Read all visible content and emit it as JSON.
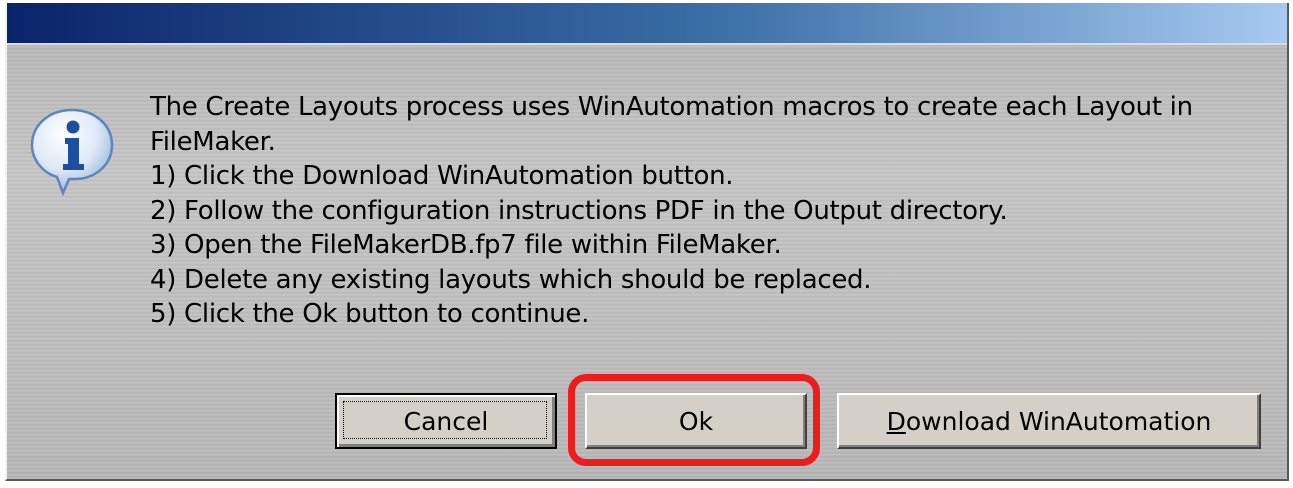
{
  "dialog": {
    "title": "",
    "icon": "information-icon",
    "message_lines": [
      "The Create Layouts process uses WinAutomation macros to create each Layout in",
      "FileMaker.",
      "1) Click the Download WinAutomation button.",
      "2) Follow the configuration instructions PDF in the Output directory.",
      "3) Open the FileMakerDB.fp7 file within FileMaker.",
      "4) Delete any existing layouts which should be replaced.",
      "5) Click the Ok button to continue."
    ]
  },
  "buttons": {
    "cancel_label": "Cancel",
    "ok_label": "Ok",
    "download_label_accel": "D",
    "download_label_rest": "ownload WinAutomation"
  },
  "annotation": {
    "highlight_color": "#ee1c1c",
    "highlight_target": "ok-button"
  },
  "colors": {
    "titlebar_start": "#0a246a",
    "titlebar_end": "#a6caf0",
    "dialog_face": "#c0c0c0"
  }
}
